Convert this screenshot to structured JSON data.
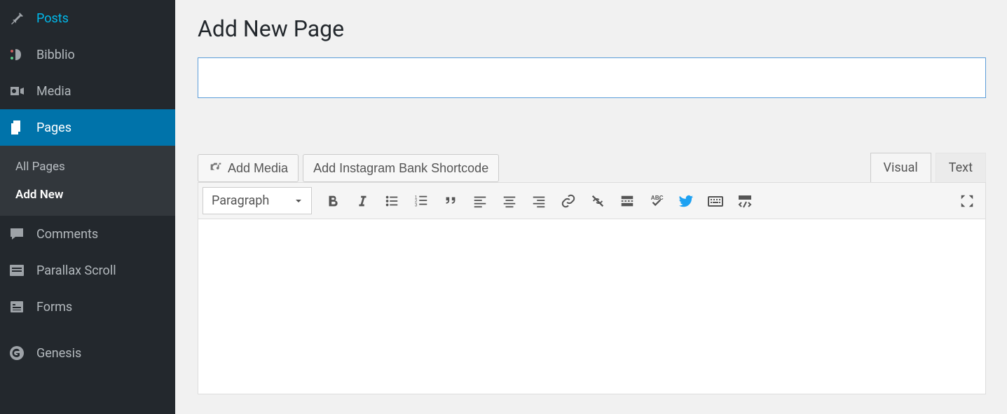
{
  "sidebar": {
    "items": [
      {
        "label": "Posts",
        "icon": "pin"
      },
      {
        "label": "Bibblio",
        "icon": "bibblio"
      },
      {
        "label": "Media",
        "icon": "media"
      },
      {
        "label": "Pages",
        "icon": "pages",
        "active": true,
        "submenu": [
          {
            "label": "All Pages"
          },
          {
            "label": "Add New",
            "active": true
          }
        ]
      },
      {
        "label": "Comments",
        "icon": "comment"
      },
      {
        "label": "Parallax Scroll",
        "icon": "parallax"
      },
      {
        "label": "Forms",
        "icon": "forms"
      },
      {
        "label": "Genesis",
        "icon": "genesis"
      }
    ]
  },
  "page": {
    "title": "Add New Page",
    "title_input_value": ""
  },
  "buttons": {
    "add_media": "Add Media",
    "add_instagram": "Add Instagram Bank Shortcode"
  },
  "tabs": {
    "visual": "Visual",
    "text": "Text"
  },
  "toolbar": {
    "format": "Paragraph"
  }
}
